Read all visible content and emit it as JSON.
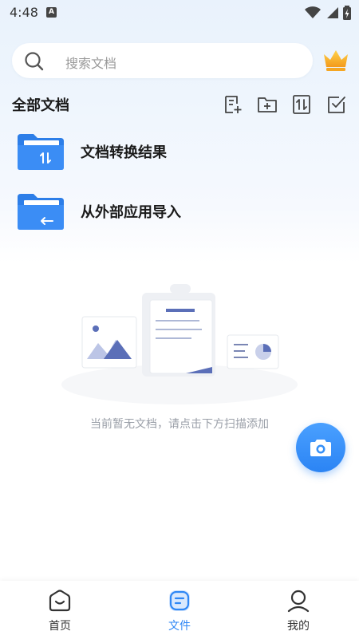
{
  "status_bar": {
    "time": "4:48",
    "notification_letter": "A"
  },
  "search": {
    "placeholder": "搜索文档"
  },
  "section": {
    "title": "全部文档"
  },
  "toolbar": [
    "new-document-icon",
    "new-folder-icon",
    "sort-icon",
    "select-icon"
  ],
  "folders": [
    {
      "label": "文档转换结果",
      "icon": "folder-convert-icon"
    },
    {
      "label": "从外部应用导入",
      "icon": "folder-import-icon"
    }
  ],
  "empty_state": {
    "message": "当前暂无文档，请点击下方扫描添加"
  },
  "nav": {
    "items": [
      {
        "label": "首页",
        "icon": "home-icon",
        "active": false
      },
      {
        "label": "文件",
        "icon": "files-icon",
        "active": true
      },
      {
        "label": "我的",
        "icon": "profile-icon",
        "active": false
      }
    ]
  },
  "colors": {
    "accent": "#2f87f5",
    "folder": "#3b8df5",
    "crown": "#f5a623"
  }
}
